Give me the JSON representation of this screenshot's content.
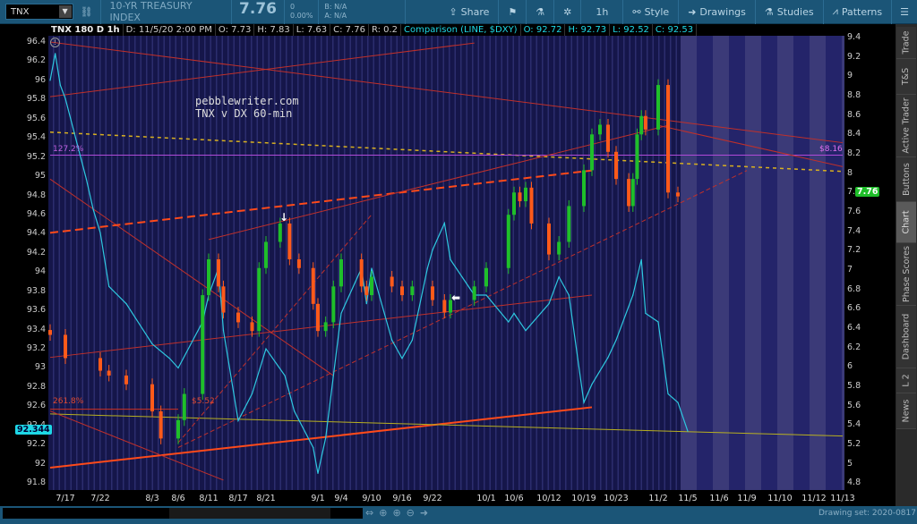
{
  "toolbar": {
    "symbol": "TNX",
    "description": "10-YR TREASURY INDEX",
    "last": "7.76",
    "change": "0",
    "change_pct": "0.00%",
    "bid": "B: N/A",
    "ask": "A: N/A",
    "share": "Share",
    "interval": "1h",
    "style": "Style",
    "drawings": "Drawings",
    "studies": "Studies",
    "patterns": "Patterns"
  },
  "infobar": {
    "title": "TNX 180 D 1h",
    "date": "D: 11/5/20 2:00 PM",
    "open": "O: 7.73",
    "high": "H: 7.83",
    "low": "L: 7.63",
    "close": "C: 7.76",
    "range": "R: 0.2",
    "comparison": "Comparison (LINE, $DXY)",
    "c_open": "O: 92.72",
    "c_high": "H: 92.73",
    "c_low": "L: 92.52",
    "c_close": "C: 92.53"
  },
  "annotation": {
    "line1": "pebblewriter.com",
    "line2": "TNX v DX 60-min"
  },
  "fib_labels": {
    "upper": "127.2%",
    "upper_price": "$8.16",
    "lower": "261.8%",
    "lower_price": "$5.52"
  },
  "price_tags": {
    "dxy": "92.344",
    "tnx": "7.76"
  },
  "sidebar": {
    "tabs": [
      "Trade",
      "T&S",
      "Active Trader",
      "Buttons",
      "Chart",
      "Phase Scores",
      "Dashboard",
      "L 2",
      "News"
    ],
    "selected": "Chart"
  },
  "bottom": {
    "drawing_set": "Drawing set: 2020-0817"
  },
  "colors": {
    "dxy_line": "#2ec8e0",
    "candle_up": "#1fbf2a",
    "candle_down": "#ff5a1a",
    "fib_upper": "#b04ad8",
    "trend": "#c0302a",
    "accent": "#1b5577"
  },
  "chart_data": {
    "type": "line",
    "left_axis": {
      "ticks": [
        "96.4",
        "96.2",
        "96",
        "95.8",
        "95.6",
        "95.4",
        "95.2",
        "95",
        "94.8",
        "94.6",
        "94.4",
        "94.2",
        "94",
        "93.8",
        "93.6",
        "93.4",
        "93.2",
        "93",
        "92.8",
        "92.6",
        "92.4",
        "92.2",
        "92",
        "91.8"
      ],
      "range": [
        91.8,
        96.4
      ]
    },
    "right_axis": {
      "ticks": [
        "9.4",
        "9.2",
        "9",
        "8.8",
        "8.6",
        "8.4",
        "8.2",
        "8",
        "7.8",
        "7.6",
        "7.4",
        "7.2",
        "7",
        "6.8",
        "6.6",
        "6.4",
        "6.2",
        "6",
        "5.8",
        "5.6",
        "5.4",
        "5.2",
        "5",
        "4.8"
      ],
      "range": [
        4.8,
        9.4
      ]
    },
    "x_ticks": [
      "7/17",
      "7/22",
      "8/3",
      "8/6",
      "8/11",
      "8/17",
      "8/21",
      "9/1",
      "9/4",
      "9/10",
      "9/16",
      "9/22",
      "10/1",
      "10/6",
      "10/12",
      "10/19",
      "10/23",
      "11/2",
      "11/5",
      "11/6",
      "11/9",
      "11/10",
      "11/12",
      "11/13"
    ],
    "series": [
      {
        "name": "$DXY",
        "axis": "left",
        "style": "line",
        "points": [
          [
            "7/14",
            96.0
          ],
          [
            "7/15",
            96.28
          ],
          [
            "7/16",
            95.95
          ],
          [
            "7/17",
            95.81
          ],
          [
            "7/20",
            94.97
          ],
          [
            "7/21",
            94.65
          ],
          [
            "7/22",
            94.41
          ],
          [
            "7/24",
            93.85
          ],
          [
            "7/28",
            93.67
          ],
          [
            "7/30",
            93.53
          ],
          [
            "8/3",
            93.25
          ],
          [
            "8/5",
            93.1
          ],
          [
            "8/6",
            93.0
          ],
          [
            "8/10",
            93.48
          ],
          [
            "8/11",
            93.76
          ],
          [
            "8/13",
            94.04
          ],
          [
            "8/14",
            93.39
          ],
          [
            "8/17",
            92.45
          ],
          [
            "8/19",
            92.73
          ],
          [
            "8/21",
            93.2
          ],
          [
            "8/25",
            92.92
          ],
          [
            "8/27",
            92.55
          ],
          [
            "8/31",
            92.17
          ],
          [
            "9/1",
            91.9
          ],
          [
            "9/2",
            92.27
          ],
          [
            "9/3",
            92.92
          ],
          [
            "9/4",
            93.57
          ],
          [
            "9/8",
            94.04
          ],
          [
            "9/9",
            93.67
          ],
          [
            "9/10",
            94.04
          ],
          [
            "9/14",
            93.29
          ],
          [
            "9/16",
            93.1
          ],
          [
            "9/18",
            93.29
          ],
          [
            "9/21",
            94.04
          ],
          [
            "9/22",
            94.23
          ],
          [
            "9/24",
            94.51
          ],
          [
            "9/25",
            94.13
          ],
          [
            "9/29",
            93.76
          ],
          [
            "10/1",
            93.76
          ],
          [
            "10/5",
            93.48
          ],
          [
            "10/6",
            93.57
          ],
          [
            "10/8",
            93.39
          ],
          [
            "10/12",
            93.67
          ],
          [
            "10/14",
            93.95
          ],
          [
            "10/16",
            93.76
          ],
          [
            "10/19",
            92.64
          ],
          [
            "10/20",
            92.83
          ],
          [
            "10/22",
            93.11
          ],
          [
            "10/23",
            93.29
          ],
          [
            "10/27",
            93.76
          ],
          [
            "10/29",
            94.13
          ],
          [
            "10/30",
            93.57
          ],
          [
            "11/2",
            93.48
          ],
          [
            "11/3",
            92.73
          ],
          [
            "11/4",
            92.64
          ],
          [
            "11/5",
            92.34
          ]
        ]
      },
      {
        "name": "TNX",
        "axis": "right",
        "style": "candlestick",
        "closes": [
          [
            "7/14",
            6.33
          ],
          [
            "7/17",
            6.09
          ],
          [
            "7/22",
            5.96
          ],
          [
            "7/24",
            5.91
          ],
          [
            "7/28",
            5.82
          ],
          [
            "8/3",
            5.54
          ],
          [
            "8/4",
            5.26
          ],
          [
            "8/6",
            5.45
          ],
          [
            "8/7",
            5.72
          ],
          [
            "8/10",
            6.74
          ],
          [
            "8/11",
            7.11
          ],
          [
            "8/13",
            6.83
          ],
          [
            "8/14",
            6.56
          ],
          [
            "8/17",
            6.46
          ],
          [
            "8/19",
            6.37
          ],
          [
            "8/20",
            7.02
          ],
          [
            "8/21",
            7.29
          ],
          [
            "8/24",
            7.48
          ],
          [
            "8/26",
            7.11
          ],
          [
            "8/28",
            7.02
          ],
          [
            "8/31",
            6.65
          ],
          [
            "9/1",
            6.37
          ],
          [
            "9/2",
            6.46
          ],
          [
            "9/3",
            6.83
          ],
          [
            "9/4",
            7.11
          ],
          [
            "9/8",
            6.83
          ],
          [
            "9/9",
            6.74
          ],
          [
            "9/10",
            6.93
          ],
          [
            "9/14",
            6.83
          ],
          [
            "9/16",
            6.74
          ],
          [
            "9/18",
            6.83
          ],
          [
            "9/22",
            6.69
          ],
          [
            "9/24",
            6.56
          ],
          [
            "9/25",
            6.69
          ],
          [
            "9/29",
            6.83
          ],
          [
            "10/1",
            7.02
          ],
          [
            "10/5",
            7.57
          ],
          [
            "10/6",
            7.8
          ],
          [
            "10/7",
            7.71
          ],
          [
            "10/8",
            7.85
          ],
          [
            "10/9",
            7.48
          ],
          [
            "10/12",
            7.16
          ],
          [
            "10/14",
            7.29
          ],
          [
            "10/16",
            7.66
          ],
          [
            "10/19",
            8.03
          ],
          [
            "10/20",
            8.4
          ],
          [
            "10/21",
            8.5
          ],
          [
            "10/22",
            8.22
          ],
          [
            "10/23",
            7.94
          ],
          [
            "10/26",
            7.66
          ],
          [
            "10/27",
            7.94
          ],
          [
            "10/28",
            8.4
          ],
          [
            "10/29",
            8.59
          ],
          [
            "10/30",
            8.45
          ],
          [
            "11/2",
            8.91
          ],
          [
            "11/3",
            7.8
          ],
          [
            "11/4",
            7.76
          ]
        ]
      }
    ],
    "drawings": [
      {
        "from": [
          "7/14",
          96.4
        ],
        "to": [
          "11/13",
          95.35
        ],
        "color": "#c0302a",
        "style": "solid"
      },
      {
        "from": [
          "7/14",
          95.83
        ],
        "to": [
          "9/29",
          96.39
        ],
        "color": "#c0302a",
        "style": "solid"
      },
      {
        "from": [
          "7/14",
          94.97
        ],
        "to": [
          "9/3",
          92.92
        ],
        "color": "#c0302a",
        "style": "solid"
      },
      {
        "from": [
          "7/14",
          94.41
        ],
        "to": [
          "10/20",
          95.06
        ],
        "color": "#ff4a1a",
        "style": "dashed-thick"
      },
      {
        "from": [
          "7/14",
          91.96
        ],
        "to": [
          "10/20",
          92.59
        ],
        "color": "#ff4a1a",
        "style": "thick"
      },
      {
        "from": [
          "7/14",
          92.52
        ],
        "to": [
          "11/13",
          92.29
        ],
        "color": "#b8b020",
        "style": "solid"
      },
      {
        "from": [
          "7/14",
          95.46
        ],
        "to": [
          "11/13",
          95.05
        ],
        "color": "#d8b020",
        "style": "dotted"
      },
      {
        "from": [
          "7/14",
          95.22
        ],
        "to": [
          "11/13",
          95.22
        ],
        "color": "#b04ad8",
        "style": "solid"
      },
      {
        "from": [
          "7/14",
          92.57
        ],
        "to": [
          "8/6",
          92.57
        ],
        "color": "#d03020",
        "style": "solid"
      },
      {
        "from": [
          "7/14",
          93.11
        ],
        "to": [
          "10/20",
          93.76
        ],
        "color": "#c0302a",
        "style": "solid"
      },
      {
        "from": [
          "8/11",
          94.34
        ],
        "to": [
          "11/3",
          95.53
        ],
        "color": "#c0302a",
        "style": "solid"
      },
      {
        "from": [
          "8/6",
          92.17
        ],
        "to": [
          "11/9",
          95.06
        ],
        "color": "#c0302a",
        "style": "dashed"
      },
      {
        "from": [
          "8/6",
          92.22
        ],
        "to": [
          "9/10",
          94.6
        ],
        "color": "#c0302a",
        "style": "dashed"
      },
      {
        "from": [
          "7/14",
          92.55
        ],
        "to": [
          "8/14",
          91.83
        ],
        "color": "#c0302a",
        "style": "solid"
      },
      {
        "from": [
          "11/2",
          95.53
        ],
        "to": [
          "11/13",
          95.1
        ],
        "color": "#c0302a",
        "style": "solid"
      }
    ]
  }
}
